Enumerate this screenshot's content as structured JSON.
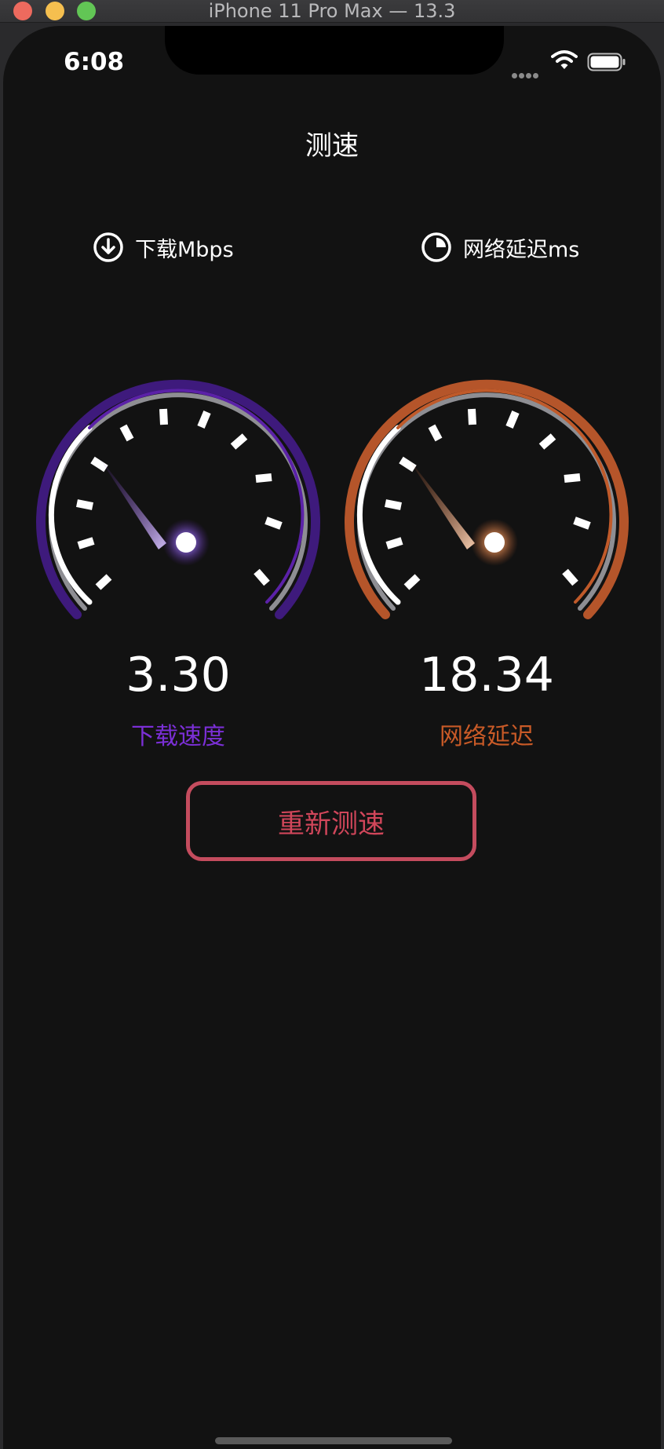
{
  "window": {
    "title": "iPhone 11 Pro Max — 13.3"
  },
  "status_bar": {
    "time": "6:08"
  },
  "header": {
    "title": "测速"
  },
  "metrics": {
    "download": {
      "header_label": "下载Mbps",
      "value": "3.30",
      "label": "下载速度",
      "accent_color": "#5b21a8",
      "label_color": "#7b2fd6"
    },
    "latency": {
      "header_label": "网络延迟ms",
      "value": "18.34",
      "label": "网络延迟",
      "accent_color": "#c05a2a",
      "label_color": "#c85a27"
    }
  },
  "actions": {
    "retest_label": "重新测速",
    "button_color": "#c44c5e"
  },
  "icons": {
    "download_icon": "arrow-down-circle-icon",
    "latency_icon": "clock-icon",
    "wifi_icon": "wifi-icon",
    "battery_icon": "battery-icon"
  }
}
